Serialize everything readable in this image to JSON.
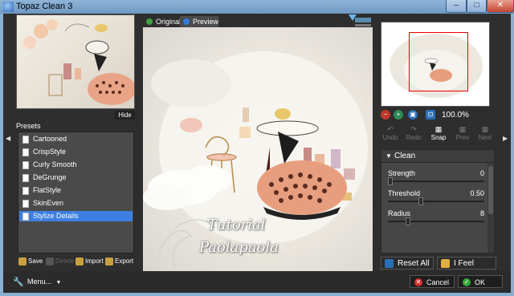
{
  "window": {
    "title": "Topaz Clean 3",
    "minimize": "–",
    "maximize": "□",
    "close": "✕"
  },
  "left": {
    "hide_label": "Hide",
    "presets_label": "Presets",
    "presets": [
      "Cartooned",
      "CrispStyle",
      "Curly Smooth",
      "DeGrunge",
      "FlatStyle",
      "SkinEven",
      "Stylize Details"
    ],
    "selected_preset": "Stylize Details",
    "toolbar": {
      "save": "Save",
      "delete": "Delete",
      "import": "Import",
      "export": "Export"
    }
  },
  "tabs": {
    "original": "Original",
    "preview": "Preview"
  },
  "preview": {
    "watermark_line1": "Tutorial",
    "watermark_line2": "Paolapaola"
  },
  "right": {
    "zoom": "100.0%",
    "tools": {
      "undo": "Undo",
      "redo": "Redo",
      "snap": "Snap",
      "prev": "Prev",
      "next": "Next"
    },
    "section": "Clean",
    "params": [
      {
        "label": "Strength",
        "value": "0",
        "fraction": 0.0
      },
      {
        "label": "Threshold",
        "value": "0.50",
        "fraction": 0.33
      },
      {
        "label": "Radius",
        "value": "8",
        "fraction": 0.19
      }
    ],
    "reset_all": "Reset All",
    "feel_lucky": "I Feel Lucky!"
  },
  "bottom": {
    "menu": "Menu...",
    "cancel": "Cancel",
    "ok": "OK"
  },
  "colors": {
    "selection": "#3c7fe0",
    "cancel": "#d32f2f",
    "ok": "#3aa43a",
    "nav_rect": "#e00000"
  }
}
